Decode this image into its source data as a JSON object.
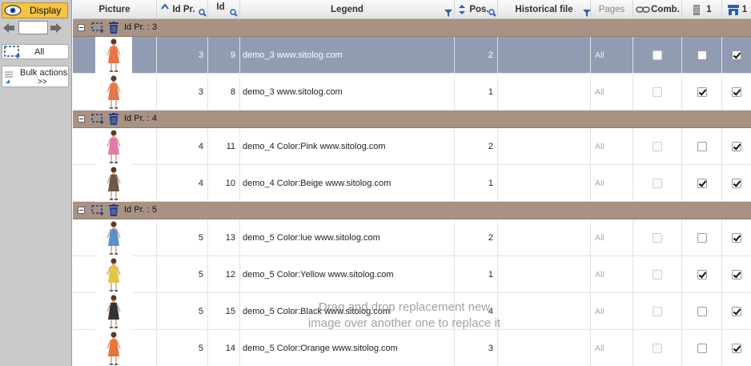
{
  "sidebar": {
    "display_label": "Display",
    "page_input_value": "",
    "all_label": "All",
    "bulk_label_1": "Bulk actions",
    "bulk_label_2": ">>"
  },
  "columns": {
    "picture": "Picture",
    "id_pr": "Id Pr.",
    "id": "Id",
    "legend": "Legend",
    "pos": "Pos.",
    "historical": "Historical file",
    "pages": "Pages",
    "comb": "Comb.",
    "col1": "1",
    "col2": "1"
  },
  "groups": [
    {
      "label": "Id Pr. : 3",
      "rows": [
        {
          "id_pr": "3",
          "id": "9",
          "legend": "demo_3  www.sitolog.com",
          "pos": "2",
          "pages": "All",
          "comb": false,
          "c1": false,
          "c2": true,
          "selected": true,
          "dress": "#e8744a"
        },
        {
          "id_pr": "3",
          "id": "8",
          "legend": "demo_3  www.sitolog.com",
          "pos": "1",
          "pages": "All",
          "comb": false,
          "c1": true,
          "c2": true,
          "selected": false,
          "dress": "#e8744a"
        }
      ]
    },
    {
      "label": "Id Pr. : 4",
      "rows": [
        {
          "id_pr": "4",
          "id": "11",
          "legend": "demo_4  Color:Pink www.sitolog.com",
          "pos": "2",
          "pages": "All",
          "comb": false,
          "c1": false,
          "c2": true,
          "selected": false,
          "dress": "#e07aa8"
        },
        {
          "id_pr": "4",
          "id": "10",
          "legend": "demo_4  Color:Beige www.sitolog.com",
          "pos": "1",
          "pages": "All",
          "comb": false,
          "c1": true,
          "c2": true,
          "selected": false,
          "dress": "#6a5a4a"
        }
      ]
    },
    {
      "label": "Id Pr. : 5",
      "rows": [
        {
          "id_pr": "5",
          "id": "13",
          "legend": "demo_5  Color:lue www.sitolog.com",
          "pos": "2",
          "pages": "All",
          "comb": false,
          "c1": false,
          "c2": true,
          "selected": false,
          "dress": "#5a8fd0"
        },
        {
          "id_pr": "5",
          "id": "12",
          "legend": "demo_5  Color:Yellow www.sitolog.com",
          "pos": "1",
          "pages": "All",
          "comb": false,
          "c1": true,
          "c2": true,
          "selected": false,
          "dress": "#e2c640"
        },
        {
          "id_pr": "5",
          "id": "15",
          "legend": "demo_5  Color:Black www.sitolog.com",
          "pos": "4",
          "pages": "All",
          "comb": false,
          "c1": false,
          "c2": true,
          "selected": false,
          "dress": "#333333"
        },
        {
          "id_pr": "5",
          "id": "14",
          "legend": "demo_5  Color:Orange www.sitolog.com",
          "pos": "3",
          "pages": "All",
          "comb": false,
          "c1": false,
          "c2": true,
          "selected": false,
          "dress": "#e8743a"
        }
      ]
    }
  ],
  "drop_hint": "Drag and drop replacement new image over another one to replace it"
}
